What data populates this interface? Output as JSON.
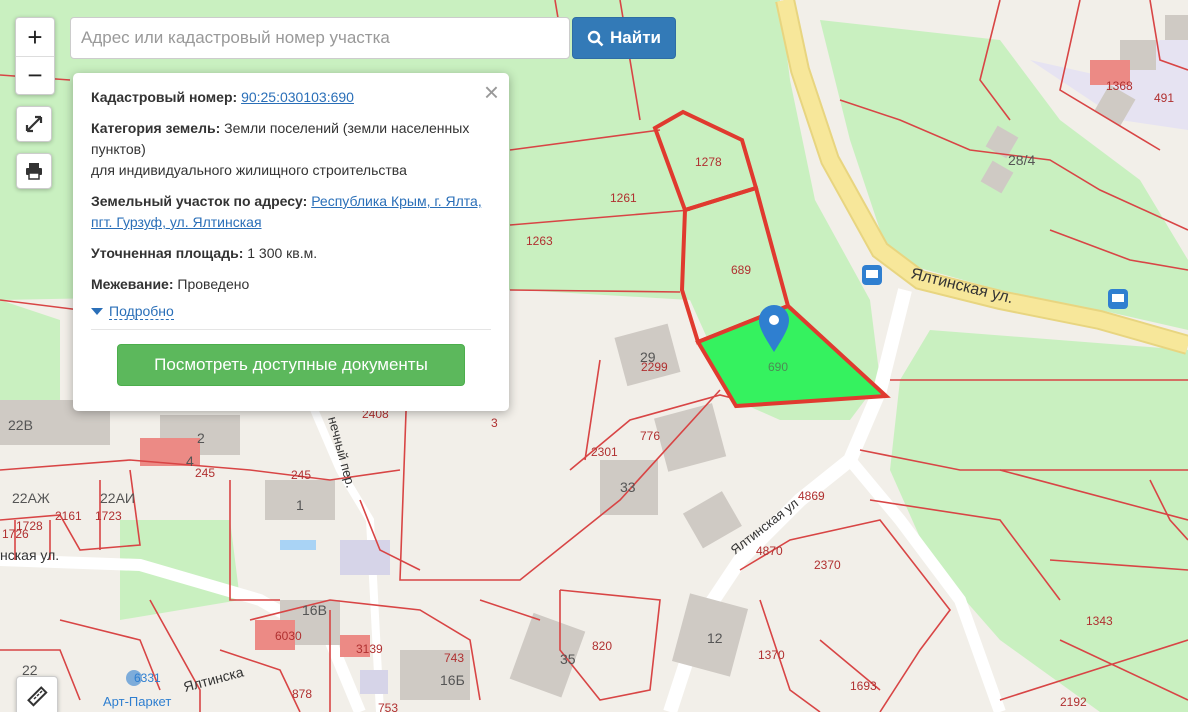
{
  "search": {
    "placeholder": "Адрес или кадастровый номер участка",
    "value": "",
    "button_label": "Найти"
  },
  "controls": {
    "zoom_in": "+",
    "zoom_out": "−"
  },
  "popup": {
    "cadastral_label": "Кадастровый номер:",
    "cadastral_value": "90:25:030103:690",
    "category_label": "Категория земель:",
    "category_value": "Земли поселений (земли населенных пунктов)",
    "category_use": "для индивидуального жилищного строительства",
    "address_label": "Земельный участок по адресу:",
    "address_value": "Республика Крым, г. Ялта, пгт. Гурзуф, ул. Ялтинская",
    "area_label": "Уточненная площадь:",
    "area_value": "1 300 кв.м.",
    "survey_label": "Межевание:",
    "survey_value": "Проведено",
    "details_link": "Подробно",
    "docs_button": "Посмотреть доступные документы",
    "close": "×"
  },
  "map": {
    "parcel_labels": [
      "1278",
      "1261",
      "689",
      "690",
      "1263",
      "2299",
      "2301",
      "776",
      "2408",
      "3",
      "245",
      "245",
      "2161",
      "1723",
      "1728",
      "1726",
      "4869",
      "4870",
      "2370",
      "1343",
      "820",
      "1370",
      "1693",
      "743",
      "3139",
      "6030",
      "878",
      "753",
      "6331",
      "1368",
      "491",
      "2192"
    ],
    "house_labels": [
      "29",
      "33",
      "22В",
      "2",
      "4",
      "22АЖ",
      "22АИ",
      "1",
      "16В",
      "16Б",
      "12",
      "35",
      "22",
      "28/4"
    ],
    "streets": {
      "main": "Ялтинская ул.",
      "diagonal": "Ялтинская ул",
      "left": "нская ул.",
      "bottom": "Ялтинска",
      "lane": "нечный пер."
    },
    "poi": "Арт-Паркет",
    "colors": {
      "selected_fill": "#35f25f",
      "selected_border": "#e03a2f",
      "parcel_line": "#d84545",
      "green_area": "#c9f0c0",
      "road": "#f7e79a",
      "marker": "#2f7fd0"
    }
  }
}
